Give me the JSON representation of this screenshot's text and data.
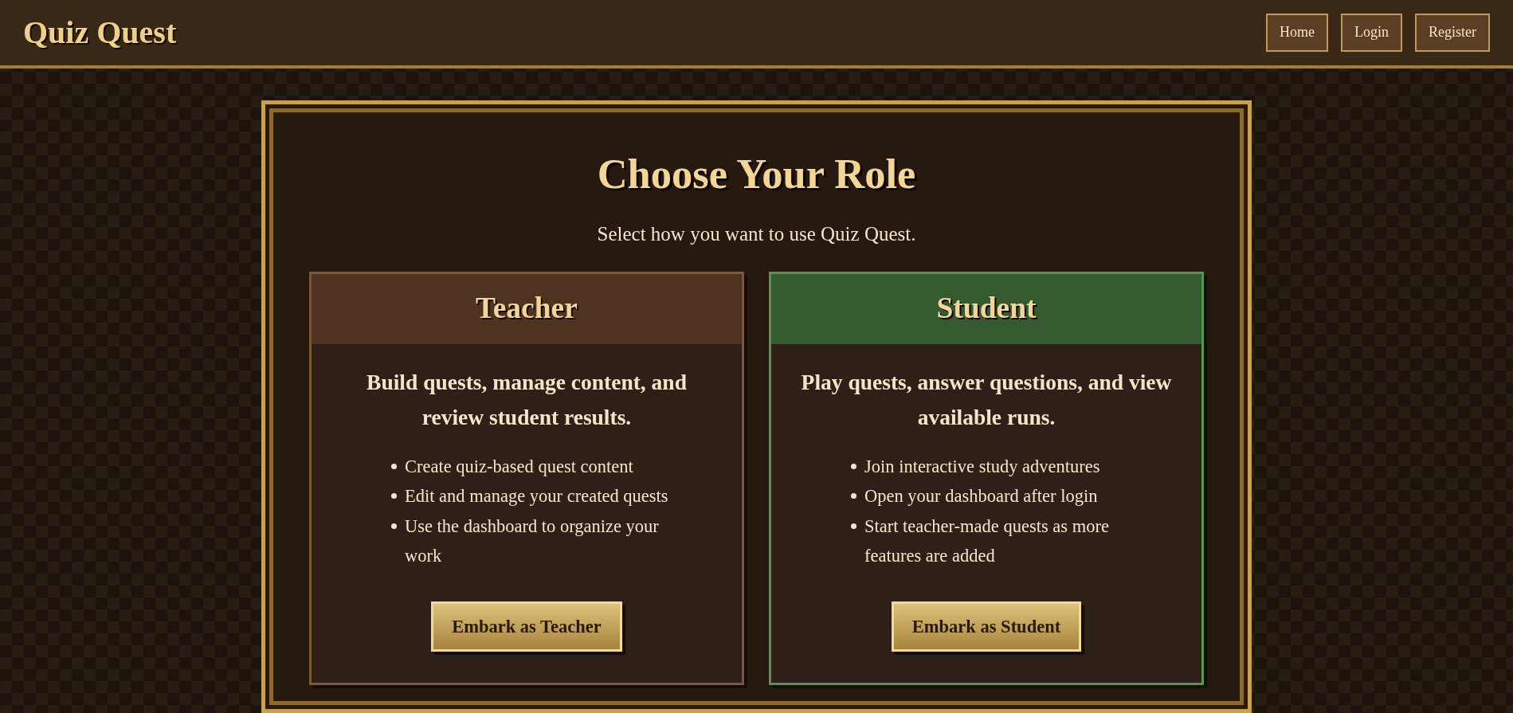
{
  "header": {
    "brand": "Quiz Quest",
    "nav": [
      "Home",
      "Login",
      "Register"
    ]
  },
  "main": {
    "title": "Choose Your Role",
    "subtitle": "Select how you want to use Quiz Quest.",
    "roles": [
      {
        "title": "Teacher",
        "color": "#4e3420",
        "lead": "Build quests, manage content, and review student results.",
        "features": [
          "Create quiz-based quest content",
          "Edit and manage your created quests",
          "Use the dashboard to organize your work"
        ],
        "button": "Embark as Teacher"
      },
      {
        "title": "Student",
        "color": "#355a2f",
        "lead": "Play quests, answer questions, and view available runs.",
        "features": [
          "Join interactive study adventures",
          "Open your dashboard after login",
          "Start teacher-made quests as more features are added"
        ],
        "button": "Embark as Student"
      }
    ]
  }
}
